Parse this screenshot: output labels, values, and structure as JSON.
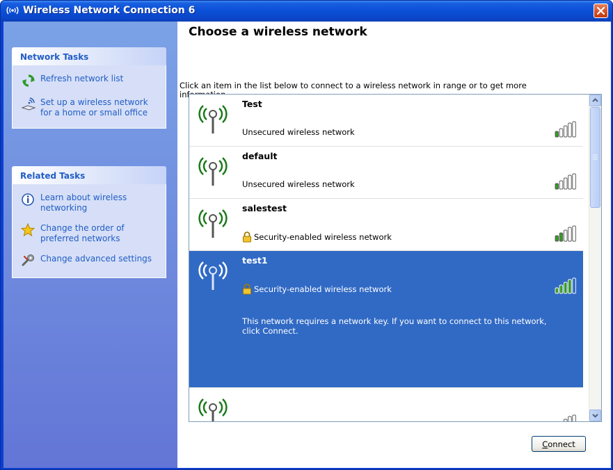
{
  "window": {
    "title": "Wireless Network Connection 6"
  },
  "left_panel": {
    "network_tasks": {
      "title": "Network Tasks",
      "items": [
        {
          "label": "Refresh network list",
          "icon": "refresh-icon"
        },
        {
          "label": "Set up a wireless network for a home or small office",
          "icon": "wireless-setup-icon"
        }
      ]
    },
    "related_tasks": {
      "title": "Related Tasks",
      "items": [
        {
          "label": "Learn about wireless networking",
          "icon": "info-icon"
        },
        {
          "label": "Change the order of preferred networks",
          "icon": "star-icon"
        },
        {
          "label": "Change advanced settings",
          "icon": "settings-icon"
        }
      ]
    }
  },
  "main": {
    "heading": "Choose a wireless network",
    "instruction": "Click an item in the list below to connect to a wireless network in range or to get more information.",
    "networks": [
      {
        "name": "Test",
        "status": "Unsecured wireless network",
        "secured": false,
        "signal_bars": 1
      },
      {
        "name": "default",
        "status": "Unsecured wireless network",
        "secured": false,
        "signal_bars": 1
      },
      {
        "name": "salestest",
        "status": "Security-enabled wireless network",
        "secured": true,
        "signal_bars": 2
      },
      {
        "name": "test1",
        "status": "Security-enabled wireless network",
        "secured": true,
        "signal_bars": 4,
        "selected": true,
        "description": "This network requires a network key. If you want to connect to this network, click Connect."
      },
      {
        "name": "",
        "status": "",
        "secured": false,
        "signal_bars": 1
      }
    ],
    "connect_label_underlined": "C",
    "connect_label_rest": "onnect"
  },
  "colors": {
    "titlebar": "#0a4fd6",
    "task_link": "#215dc6",
    "selection": "#316ac5",
    "signal_on": "#3a9a2a"
  }
}
